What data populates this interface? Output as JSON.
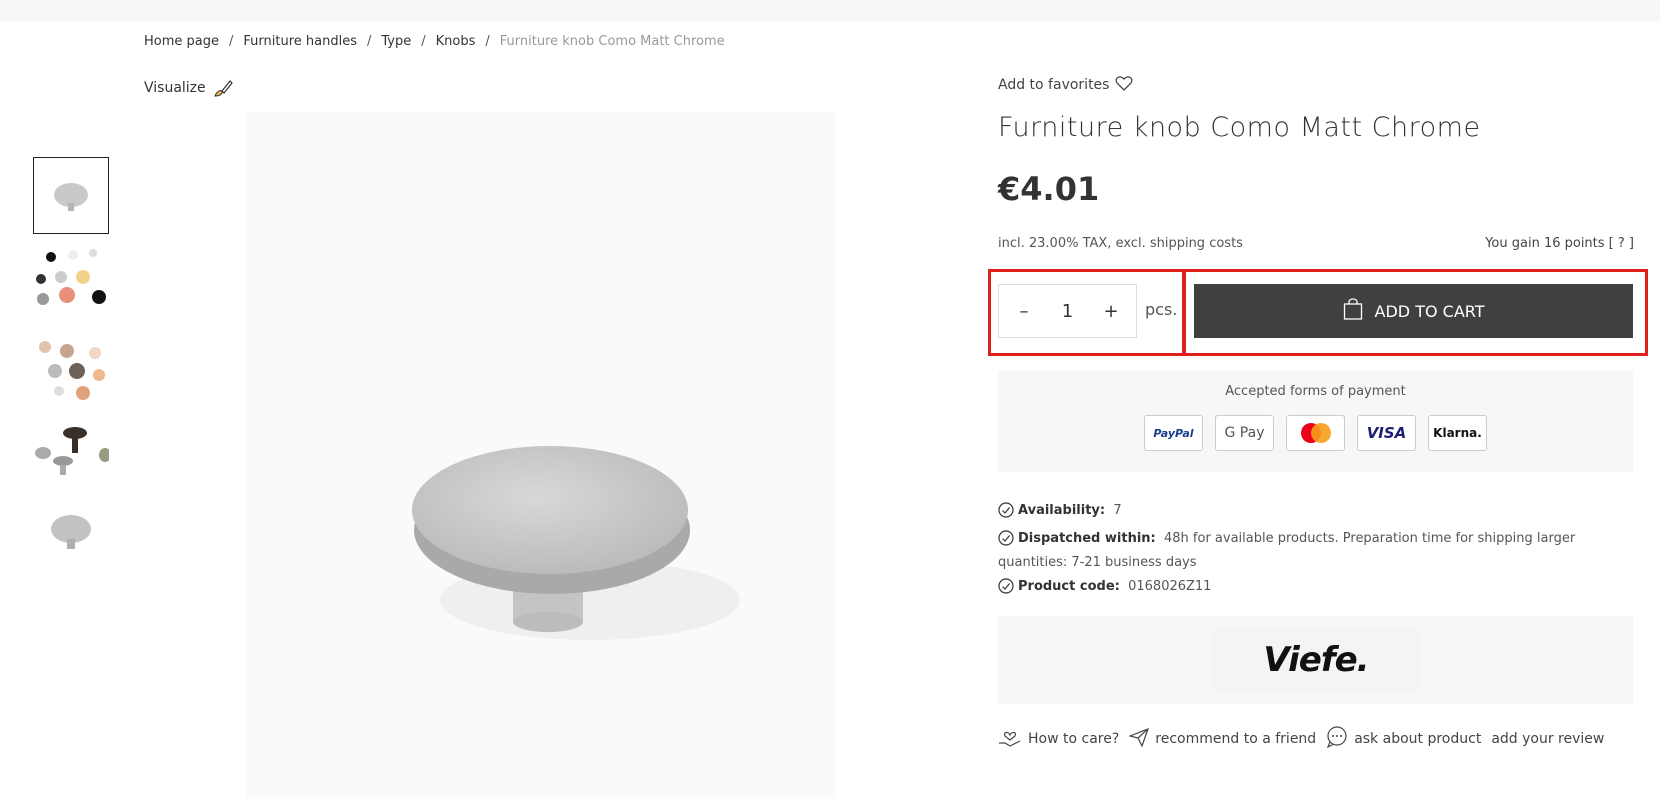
{
  "breadcrumb": {
    "items": [
      "Home page",
      "Furniture handles",
      "Type",
      "Knobs"
    ],
    "current": "Furniture knob Como Matt Chrome"
  },
  "visualize": {
    "label": "Visualize"
  },
  "product": {
    "favorites_label": "Add to favorites",
    "title": "Furniture knob Como Matt Chrome",
    "price": "€4.01",
    "tax_note": "incl. 23.00% TAX, excl. shipping costs",
    "points": "You gain 16 points [ ? ]"
  },
  "cart": {
    "minus": "–",
    "quantity": "1",
    "plus": "+",
    "unit": "pcs.",
    "add_label": "ADD TO CART"
  },
  "payments": {
    "label": "Accepted forms of payment",
    "methods": [
      "PayPal",
      "G Pay",
      "",
      "VISA",
      "Klarna."
    ]
  },
  "info": {
    "availability_label": "Availability:",
    "availability_value": "7",
    "dispatch_label": "Dispatched within:",
    "dispatch_value": "48h for available products. Preparation time for shipping larger quantities: 7-21 business days",
    "code_label": "Product code:",
    "code_value": "0168026Z11"
  },
  "brand": {
    "name": "Viefe."
  },
  "actions": {
    "care": "How to care?",
    "recommend": "recommend to a friend",
    "ask": "ask about product",
    "review": "add your review"
  },
  "colors": {
    "highlight": "#e0201c",
    "button": "#404040"
  }
}
